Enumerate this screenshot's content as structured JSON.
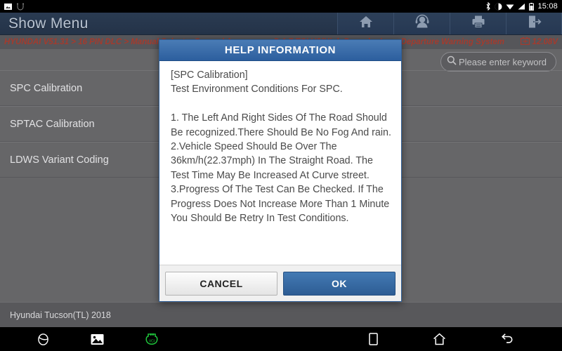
{
  "status_bar": {
    "time": "15:08",
    "left_icons": [
      "screenshot-icon",
      "usb-debug-icon"
    ],
    "right_icons": [
      "bluetooth-icon",
      "sound-icon",
      "wifi-icon",
      "signal-icon",
      "battery-icon"
    ]
  },
  "header": {
    "title": "Show Menu",
    "tools": [
      {
        "name": "home-button",
        "icon": "home-icon"
      },
      {
        "name": "support-button",
        "icon": "headset-icon"
      },
      {
        "name": "print-button",
        "icon": "printer-icon"
      },
      {
        "name": "exit-button",
        "icon": "exit-icon"
      }
    ]
  },
  "breadcrumb": {
    "path": "HYUNDAI V51.31 > 16 PIN DLC > Manual Select > General Areas > ... > D 1.7 TCI U2(High Power) > Lane Departure Warning System",
    "voltage": "12.08V",
    "battery_icon": "battery-icon",
    "color": "#a33b2e"
  },
  "search": {
    "placeholder": "Please enter keyword",
    "icon": "search-icon",
    "value": ""
  },
  "menu": {
    "items": [
      {
        "label": "SPC Calibration"
      },
      {
        "label": "SPTAC Calibration"
      },
      {
        "label": "LDWS Variant Coding"
      }
    ]
  },
  "vehicle_bar": {
    "vehicle": "Hyundai Tucson(TL) 2018"
  },
  "nav_bar": {
    "left": [
      "browser-icon",
      "gallery-icon",
      "vci-connector-icon"
    ],
    "right": [
      "recents-icon",
      "home-icon",
      "back-icon"
    ],
    "vci_color": "#1fc83c"
  },
  "dialog": {
    "title": "HELP INFORMATION",
    "body": "[SPC Calibration]\nTest Environment Conditions For SPC.\n\n1. The Left And Right Sides Of The Road Should Be recognized.There Should Be No Fog And rain.\n2.Vehicle Speed Should Be Over The 36km/h(22.37mph) In The Straight Road. The Test Time May Be Increased At Curve street.\n3.Progress Of The Test Can Be Checked. If The Progress Does Not Increase More Than 1 Minute You Should Be Retry In Test Conditions.",
    "cancel_label": "CANCEL",
    "ok_label": "OK",
    "accent_color": "#2d5c94"
  }
}
